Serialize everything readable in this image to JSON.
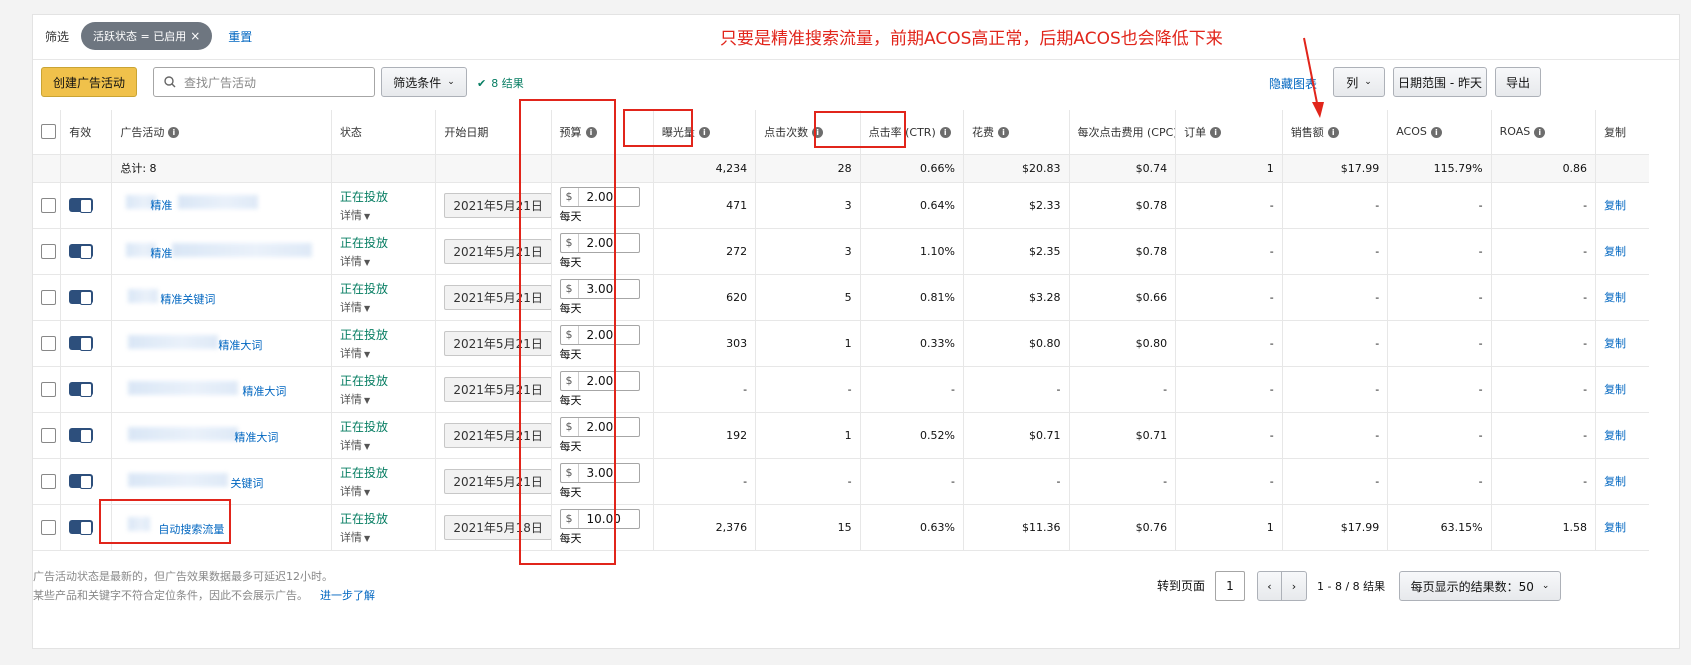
{
  "filter": {
    "label": "筛选",
    "chip": "活跃状态 = 已启用",
    "chip_close": "×",
    "reset": "重置"
  },
  "toolbar": {
    "create_button": "创建广告活动",
    "search_placeholder": "查找广告活动",
    "filter_conditions": "筛选条件",
    "result_count": "8 结果",
    "hide_chart": "隐藏图表",
    "columns_button": "列",
    "date_range_button": "日期范围 - 昨天",
    "export_button": "导出"
  },
  "annotation": "只要是精准搜索流量，前期ACOS高正常，后期ACOS也会降低下来",
  "headers": {
    "active": "有效",
    "campaign": "广告活动",
    "status": "状态",
    "start_date": "开始日期",
    "budget": "预算",
    "impressions": "曝光量",
    "clicks": "点击次数",
    "ctr": "点击率 (CTR)",
    "spend": "花费",
    "cpc": "每次点击费用 (CPC)",
    "orders": "订单",
    "sales": "销售额",
    "acos": "ACOS",
    "roas": "ROAS",
    "copy": "复制"
  },
  "totals": {
    "label": "总计: 8",
    "impressions": "4,234",
    "clicks": "28",
    "ctr": "0.66%",
    "spend": "$20.83",
    "cpc": "$0.74",
    "orders": "1",
    "sales": "$17.99",
    "acos": "115.79%",
    "roas": "0.86"
  },
  "rows": [
    {
      "name": "精准",
      "status": "正在投放",
      "detail": "详情",
      "start_date": "2021年5月21日",
      "currency": "$",
      "budget": "2.00",
      "budget_unit": "每天",
      "impressions": "471",
      "clicks": "3",
      "ctr": "0.64%",
      "spend": "$2.33",
      "cpc": "$0.78",
      "orders": "-",
      "sales": "-",
      "acos": "-",
      "roas": "-",
      "copy": "复制"
    },
    {
      "name": "精准",
      "status": "正在投放",
      "detail": "详情",
      "start_date": "2021年5月21日",
      "currency": "$",
      "budget": "2.00",
      "budget_unit": "每天",
      "impressions": "272",
      "clicks": "3",
      "ctr": "1.10%",
      "spend": "$2.35",
      "cpc": "$0.78",
      "orders": "-",
      "sales": "-",
      "acos": "-",
      "roas": "-",
      "copy": "复制"
    },
    {
      "name": "精准关键词",
      "status": "正在投放",
      "detail": "详情",
      "start_date": "2021年5月21日",
      "currency": "$",
      "budget": "3.00",
      "budget_unit": "每天",
      "impressions": "620",
      "clicks": "5",
      "ctr": "0.81%",
      "spend": "$3.28",
      "cpc": "$0.66",
      "orders": "-",
      "sales": "-",
      "acos": "-",
      "roas": "-",
      "copy": "复制"
    },
    {
      "name": "精准大词",
      "status": "正在投放",
      "detail": "详情",
      "start_date": "2021年5月21日",
      "currency": "$",
      "budget": "2.00",
      "budget_unit": "每天",
      "impressions": "303",
      "clicks": "1",
      "ctr": "0.33%",
      "spend": "$0.80",
      "cpc": "$0.80",
      "orders": "-",
      "sales": "-",
      "acos": "-",
      "roas": "-",
      "copy": "复制"
    },
    {
      "name": "精准大词",
      "status": "正在投放",
      "detail": "详情",
      "start_date": "2021年5月21日",
      "currency": "$",
      "budget": "2.00",
      "budget_unit": "每天",
      "impressions": "-",
      "clicks": "-",
      "ctr": "-",
      "spend": "-",
      "cpc": "-",
      "orders": "-",
      "sales": "-",
      "acos": "-",
      "roas": "-",
      "copy": "复制"
    },
    {
      "name": "精准大词",
      "status": "正在投放",
      "detail": "详情",
      "start_date": "2021年5月21日",
      "currency": "$",
      "budget": "2.00",
      "budget_unit": "每天",
      "impressions": "192",
      "clicks": "1",
      "ctr": "0.52%",
      "spend": "$0.71",
      "cpc": "$0.71",
      "orders": "-",
      "sales": "-",
      "acos": "-",
      "roas": "-",
      "copy": "复制"
    },
    {
      "name": "关键词",
      "status": "正在投放",
      "detail": "详情",
      "start_date": "2021年5月21日",
      "currency": "$",
      "budget": "3.00",
      "budget_unit": "每天",
      "impressions": "-",
      "clicks": "-",
      "ctr": "-",
      "spend": "-",
      "cpc": "-",
      "orders": "-",
      "sales": "-",
      "acos": "-",
      "roas": "-",
      "copy": "复制"
    },
    {
      "name": "自动搜索流量",
      "status": "正在投放",
      "detail": "详情",
      "start_date": "2021年5月18日",
      "currency": "$",
      "budget": "10.00",
      "budget_unit": "每天",
      "impressions": "2,376",
      "clicks": "15",
      "ctr": "0.63%",
      "spend": "$11.36",
      "cpc": "$0.76",
      "orders": "1",
      "sales": "$17.99",
      "acos": "63.15%",
      "roas": "1.58",
      "copy": "复制"
    }
  ],
  "footer": {
    "note1": "广告活动状态是最新的，但广告效果数据最多可延迟12小时。",
    "note2": "某些产品和关键字不符合定位条件，因此不会展示广告。",
    "learn_more": "进一步了解",
    "goto_page": "转到页面",
    "page": "1",
    "range": "1 - 8 / 8 结果",
    "per_page": "每页显示的结果数：50"
  }
}
